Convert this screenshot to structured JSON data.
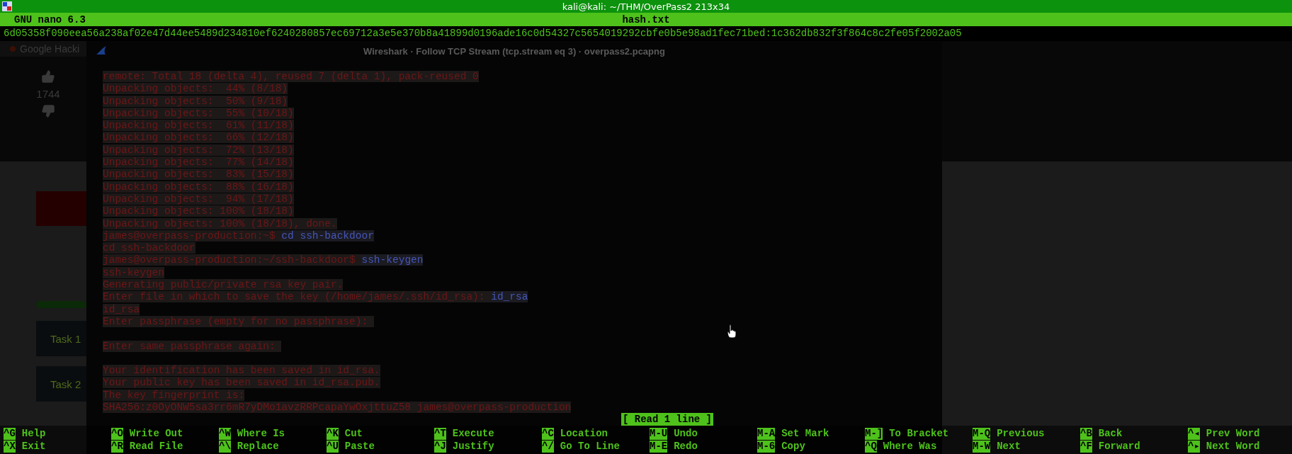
{
  "terminal": {
    "title": "kali@kali: ~/THM/OverPass2 213x34",
    "editor": "GNU nano 6.3",
    "filename": "hash.txt",
    "content_lines": [
      "6d05358f090eea56a238af02e47d44ee5489d234810ef6240280857ec69712a3e5e370b8a41899d0196ade16c0d54327c5654019292cbfe0b5e98ad1fec71bed:1c362db832f3f864c8c2fe05f2002a05"
    ],
    "status": "[ Read 1 line ]",
    "shortcut_columns": [
      [
        {
          "key": "^G",
          "label": "Help"
        },
        {
          "key": "^X",
          "label": "Exit"
        }
      ],
      [
        {
          "key": "^O",
          "label": "Write Out"
        },
        {
          "key": "^R",
          "label": "Read File"
        }
      ],
      [
        {
          "key": "^W",
          "label": "Where Is"
        },
        {
          "key": "^\\",
          "label": "Replace"
        }
      ],
      [
        {
          "key": "^K",
          "label": "Cut"
        },
        {
          "key": "^U",
          "label": "Paste"
        }
      ],
      [
        {
          "key": "^T",
          "label": "Execute"
        },
        {
          "key": "^J",
          "label": "Justify"
        }
      ],
      [
        {
          "key": "^C",
          "label": "Location"
        },
        {
          "key": "^/",
          "label": "Go To Line"
        }
      ],
      [
        {
          "key": "M-U",
          "label": "Undo"
        },
        {
          "key": "M-E",
          "label": "Redo"
        }
      ],
      [
        {
          "key": "M-A",
          "label": "Set Mark"
        },
        {
          "key": "M-6",
          "label": "Copy"
        }
      ],
      [
        {
          "key": "M-]",
          "label": "To Bracket"
        },
        {
          "key": "^Q",
          "label": "Where Was"
        }
      ],
      [
        {
          "key": "M-Q",
          "label": "Previous"
        },
        {
          "key": "M-W",
          "label": "Next"
        }
      ],
      [
        {
          "key": "^B",
          "label": "Back"
        },
        {
          "key": "^F",
          "label": "Forward"
        }
      ],
      [
        {
          "key": "^◂",
          "label": "Prev Word"
        },
        {
          "key": "^▸",
          "label": "Next Word"
        }
      ]
    ]
  },
  "background": {
    "browser": {
      "tab_title": "Google Hacki",
      "like_count": "1744",
      "tasks": [
        "Task 1",
        "Task 2"
      ]
    },
    "wireshark": {
      "title": "Wireshark · Follow TCP Stream (tcp.stream eq 3) · overpass2.pcapng",
      "lines": [
        {
          "kind": "server",
          "text": "remote: Total 18 (delta 4), reused 7 (delta 1), pack-reused 0"
        },
        {
          "kind": "server",
          "text": "Unpacking objects:  44% (8/18)"
        },
        {
          "kind": "server",
          "text": "Unpacking objects:  50% (9/18)"
        },
        {
          "kind": "server",
          "text": "Unpacking objects:  55% (10/18)"
        },
        {
          "kind": "server",
          "text": "Unpacking objects:  61% (11/18)"
        },
        {
          "kind": "server",
          "text": "Unpacking objects:  66% (12/18)"
        },
        {
          "kind": "server",
          "text": "Unpacking objects:  72% (13/18)"
        },
        {
          "kind": "server",
          "text": "Unpacking objects:  77% (14/18)"
        },
        {
          "kind": "server",
          "text": "Unpacking objects:  83% (15/18)"
        },
        {
          "kind": "server",
          "text": "Unpacking objects:  88% (16/18)"
        },
        {
          "kind": "server",
          "text": "Unpacking objects:  94% (17/18)"
        },
        {
          "kind": "server",
          "text": "Unpacking objects: 100% (18/18)"
        },
        {
          "kind": "server",
          "text": "Unpacking objects: 100% (18/18), done."
        },
        {
          "kind": "prompt",
          "text": "james@overpass-production:~$ ",
          "command": "cd ssh-backdoor"
        },
        {
          "kind": "server",
          "text": "cd ssh-backdoor"
        },
        {
          "kind": "prompt",
          "text": "james@overpass-production:~/ssh-backdoor$ ",
          "command": "ssh-keygen"
        },
        {
          "kind": "server",
          "text": "ssh-keygen"
        },
        {
          "kind": "server",
          "text": "Generating public/private rsa key pair."
        },
        {
          "kind": "prompt",
          "text": "Enter file in which to save the key (/home/james/.ssh/id_rsa): ",
          "command": "id_rsa"
        },
        {
          "kind": "server",
          "text": "id_rsa"
        },
        {
          "kind": "server",
          "text": "Enter passphrase (empty for no passphrase): "
        },
        {
          "kind": "gap"
        },
        {
          "kind": "server",
          "text": "Enter same passphrase again: "
        },
        {
          "kind": "gap"
        },
        {
          "kind": "server",
          "text": "Your identification has been saved in id_rsa."
        },
        {
          "kind": "server",
          "text": "Your public key has been saved in id_rsa.pub."
        },
        {
          "kind": "server",
          "text": "The key fingerprint is:"
        },
        {
          "kind": "server",
          "text": "SHA256:z0OyONW5sa3rr6mR7yDMo1avzRRPcapaYwOxjttuZ58 james@overpass-production"
        }
      ]
    }
  }
}
